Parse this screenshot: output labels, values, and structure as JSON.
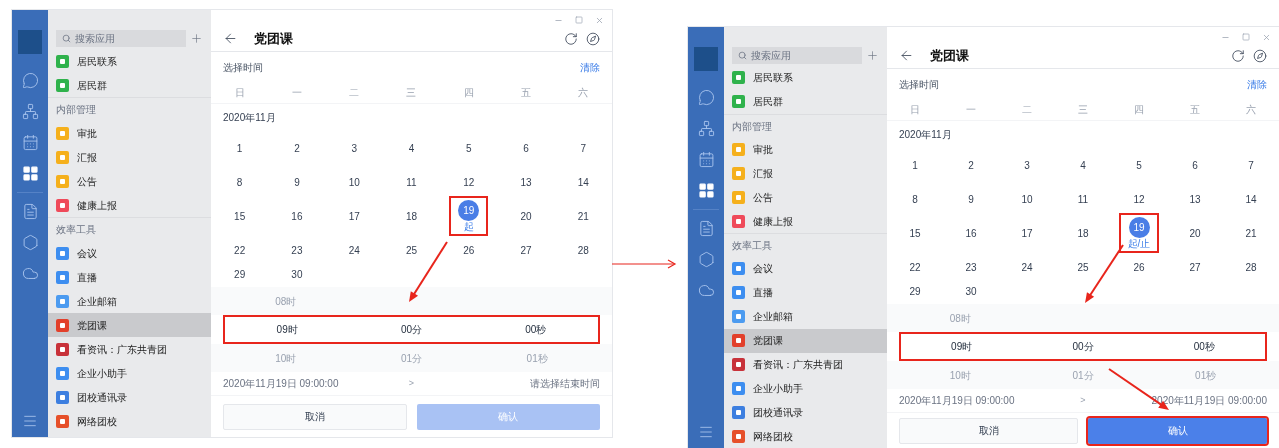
{
  "screens": [
    {
      "sidebar": {
        "search_placeholder": "搜索应用",
        "items": [
          {
            "kind": "app",
            "label": "居民联系",
            "color": "#2fb24c",
            "selected": false
          },
          {
            "kind": "app",
            "label": "居民群",
            "color": "#2fb24c",
            "selected": false
          },
          {
            "kind": "section",
            "label": "内部管理"
          },
          {
            "kind": "app",
            "label": "审批",
            "color": "#f5b01c",
            "selected": false
          },
          {
            "kind": "app",
            "label": "汇报",
            "color": "#f5b01c",
            "selected": false
          },
          {
            "kind": "app",
            "label": "公告",
            "color": "#f5b01c",
            "selected": false
          },
          {
            "kind": "app",
            "label": "健康上报",
            "color": "#ef4a5a",
            "selected": false
          },
          {
            "kind": "section",
            "label": "效率工具"
          },
          {
            "kind": "app",
            "label": "会议",
            "color": "#3d8ef0",
            "selected": false
          },
          {
            "kind": "app",
            "label": "直播",
            "color": "#3d8ef0",
            "selected": false
          },
          {
            "kind": "app",
            "label": "企业邮箱",
            "color": "#4c9bf0",
            "selected": false
          },
          {
            "kind": "app",
            "label": "党团课",
            "color": "#e2402b",
            "selected": true
          },
          {
            "kind": "app",
            "label": "看资讯：广东共青团",
            "color": "#c8323a",
            "selected": false
          },
          {
            "kind": "app",
            "label": "企业小助手",
            "color": "#3d8ef0",
            "selected": false
          },
          {
            "kind": "app",
            "label": "团校通讯录",
            "color": "#3d7fe0",
            "selected": false
          },
          {
            "kind": "app",
            "label": "网络团校",
            "color": "#e6502a",
            "selected": false
          }
        ]
      },
      "title": "党团课",
      "picker": {
        "label": "选择时间",
        "clear": "清除",
        "weekdays": [
          "日",
          "一",
          "二",
          "三",
          "四",
          "五",
          "六"
        ],
        "month": "2020年11月",
        "days": [
          {
            "label": "1",
            "selected": false
          },
          {
            "label": "2",
            "selected": false
          },
          {
            "label": "3",
            "selected": false
          },
          {
            "label": "4",
            "selected": false
          },
          {
            "label": "5",
            "selected": false
          },
          {
            "label": "6",
            "selected": false
          },
          {
            "label": "7",
            "selected": false
          },
          {
            "label": "8",
            "selected": false
          },
          {
            "label": "9",
            "selected": false
          },
          {
            "label": "10",
            "selected": false
          },
          {
            "label": "11",
            "selected": false
          },
          {
            "label": "12",
            "selected": false
          },
          {
            "label": "13",
            "selected": false
          },
          {
            "label": "14",
            "selected": false
          },
          {
            "label": "15",
            "selected": false
          },
          {
            "label": "16",
            "selected": false
          },
          {
            "label": "17",
            "selected": false
          },
          {
            "label": "18",
            "selected": false
          },
          {
            "label": "19",
            "selected": true,
            "note": "起",
            "highlighted": true
          },
          {
            "label": "20",
            "selected": false
          },
          {
            "label": "21",
            "selected": false
          },
          {
            "label": "22",
            "selected": false
          },
          {
            "label": "23",
            "selected": false
          },
          {
            "label": "24",
            "selected": false
          },
          {
            "label": "25",
            "selected": false
          },
          {
            "label": "26",
            "selected": false
          },
          {
            "label": "27",
            "selected": false
          },
          {
            "label": "28",
            "selected": false
          },
          {
            "label": "29",
            "selected": false
          },
          {
            "label": "30",
            "selected": false
          }
        ],
        "wheel": {
          "highlighted": true,
          "columns": [
            {
              "above": "08时",
              "current": "09时",
              "below": "10时"
            },
            {
              "current": "00分",
              "below": "01分"
            },
            {
              "current": "00秒",
              "below": "01秒"
            }
          ]
        },
        "start": "2020年11月19日 09:00:00",
        "separator": ">",
        "end": "请选择结束时间"
      },
      "buttons": {
        "cancel": "取消",
        "confirm": "确认",
        "confirm_disabled": true,
        "confirm_highlighted": false
      }
    },
    {
      "sidebar": {
        "search_placeholder": "搜索应用",
        "items": [
          {
            "kind": "app",
            "label": "居民联系",
            "color": "#2fb24c",
            "selected": false
          },
          {
            "kind": "app",
            "label": "居民群",
            "color": "#2fb24c",
            "selected": false
          },
          {
            "kind": "section",
            "label": "内部管理"
          },
          {
            "kind": "app",
            "label": "审批",
            "color": "#f5b01c",
            "selected": false
          },
          {
            "kind": "app",
            "label": "汇报",
            "color": "#f5b01c",
            "selected": false
          },
          {
            "kind": "app",
            "label": "公告",
            "color": "#f5b01c",
            "selected": false
          },
          {
            "kind": "app",
            "label": "健康上报",
            "color": "#ef4a5a",
            "selected": false
          },
          {
            "kind": "section",
            "label": "效率工具"
          },
          {
            "kind": "app",
            "label": "会议",
            "color": "#3d8ef0",
            "selected": false
          },
          {
            "kind": "app",
            "label": "直播",
            "color": "#3d8ef0",
            "selected": false
          },
          {
            "kind": "app",
            "label": "企业邮箱",
            "color": "#4c9bf0",
            "selected": false
          },
          {
            "kind": "app",
            "label": "党团课",
            "color": "#e2402b",
            "selected": true
          },
          {
            "kind": "app",
            "label": "看资讯：广东共青团",
            "color": "#c8323a",
            "selected": false
          },
          {
            "kind": "app",
            "label": "企业小助手",
            "color": "#3d8ef0",
            "selected": false
          },
          {
            "kind": "app",
            "label": "团校通讯录",
            "color": "#3d7fe0",
            "selected": false
          },
          {
            "kind": "app",
            "label": "网络团校",
            "color": "#e6502a",
            "selected": false
          }
        ]
      },
      "title": "党团课",
      "picker": {
        "label": "选择时间",
        "clear": "清除",
        "weekdays": [
          "日",
          "一",
          "二",
          "三",
          "四",
          "五",
          "六"
        ],
        "month": "2020年11月",
        "days": [
          {
            "label": "1",
            "selected": false
          },
          {
            "label": "2",
            "selected": false
          },
          {
            "label": "3",
            "selected": false
          },
          {
            "label": "4",
            "selected": false
          },
          {
            "label": "5",
            "selected": false
          },
          {
            "label": "6",
            "selected": false
          },
          {
            "label": "7",
            "selected": false
          },
          {
            "label": "8",
            "selected": false
          },
          {
            "label": "9",
            "selected": false
          },
          {
            "label": "10",
            "selected": false
          },
          {
            "label": "11",
            "selected": false
          },
          {
            "label": "12",
            "selected": false
          },
          {
            "label": "13",
            "selected": false
          },
          {
            "label": "14",
            "selected": false
          },
          {
            "label": "15",
            "selected": false
          },
          {
            "label": "16",
            "selected": false
          },
          {
            "label": "17",
            "selected": false
          },
          {
            "label": "18",
            "selected": false
          },
          {
            "label": "19",
            "selected": true,
            "note": "起/止",
            "highlighted": true
          },
          {
            "label": "20",
            "selected": false
          },
          {
            "label": "21",
            "selected": false
          },
          {
            "label": "22",
            "selected": false
          },
          {
            "label": "23",
            "selected": false
          },
          {
            "label": "24",
            "selected": false
          },
          {
            "label": "25",
            "selected": false
          },
          {
            "label": "26",
            "selected": false
          },
          {
            "label": "27",
            "selected": false
          },
          {
            "label": "28",
            "selected": false
          },
          {
            "label": "29",
            "selected": false
          },
          {
            "label": "30",
            "selected": false
          }
        ],
        "wheel": {
          "highlighted": true,
          "columns": [
            {
              "above": "08时",
              "current": "09时",
              "below": "10时"
            },
            {
              "current": "00分",
              "below": "01分"
            },
            {
              "current": "00秒",
              "below": "01秒"
            }
          ]
        },
        "start": "2020年11月19日 09:00:00",
        "separator": ">",
        "end": "2020年11月19日 09:00:00"
      },
      "buttons": {
        "cancel": "取消",
        "confirm": "确认",
        "confirm_disabled": false,
        "confirm_highlighted": true
      }
    }
  ]
}
